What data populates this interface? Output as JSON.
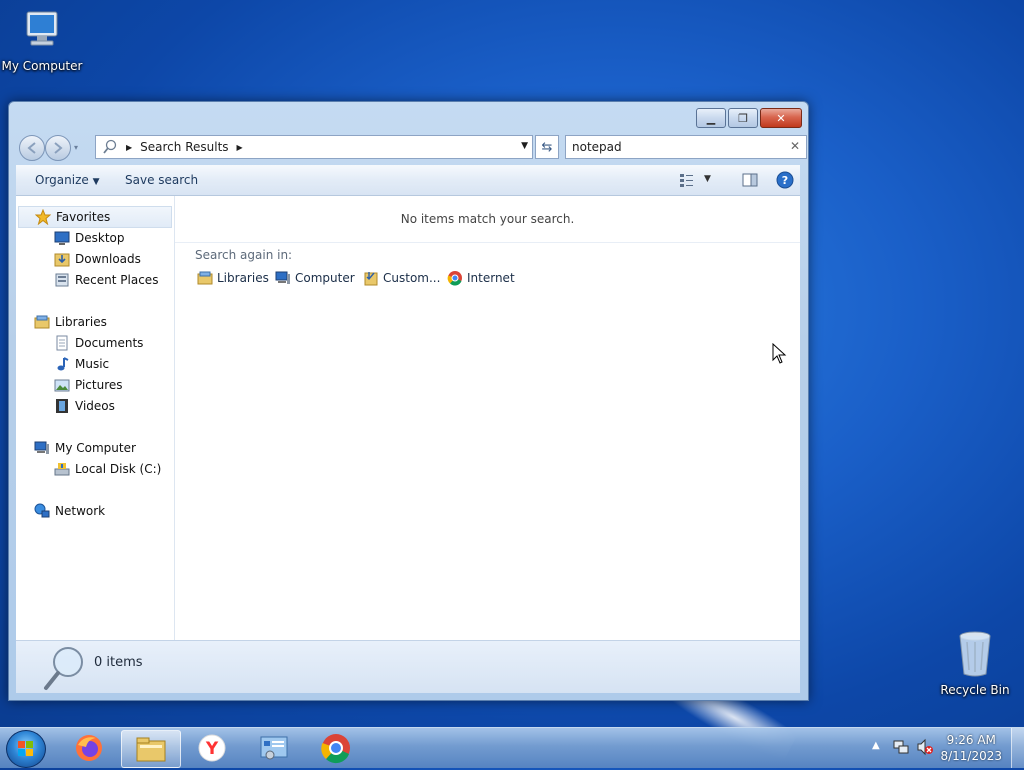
{
  "desktop": {
    "icons": [
      {
        "label": "My Computer",
        "icon": "computer-icon"
      },
      {
        "label": "Recycle Bin",
        "icon": "recycle-bin-icon"
      }
    ]
  },
  "window": {
    "address": {
      "crumb": "Search Results"
    },
    "search": {
      "value": "notepad"
    },
    "toolbar": {
      "organize": "Organize",
      "save_search": "Save search"
    },
    "nav": {
      "favorites": "Favorites",
      "desktop": "Desktop",
      "downloads": "Downloads",
      "recent": "Recent Places",
      "libraries": "Libraries",
      "documents": "Documents",
      "music": "Music",
      "pictures": "Pictures",
      "videos": "Videos",
      "mycomputer": "My Computer",
      "localdisk": "Local Disk (C:)",
      "network": "Network"
    },
    "results": {
      "message": "No items match your search.",
      "search_again": "Search again in:",
      "options": [
        "Libraries",
        "Computer",
        "Custom...",
        "Internet"
      ]
    },
    "status": {
      "count": "0 items"
    }
  },
  "taskbar": {
    "apps": [
      "start-button",
      "firefox",
      "windows-explorer",
      "yandex-browser",
      "control-panel",
      "chrome"
    ],
    "clock": {
      "time": "9:26 AM",
      "date": "8/11/2023"
    }
  },
  "colors": {
    "window_frame": "#b7cfe9",
    "desktop": "#1a5fc8",
    "close_button": "#c0391d"
  }
}
